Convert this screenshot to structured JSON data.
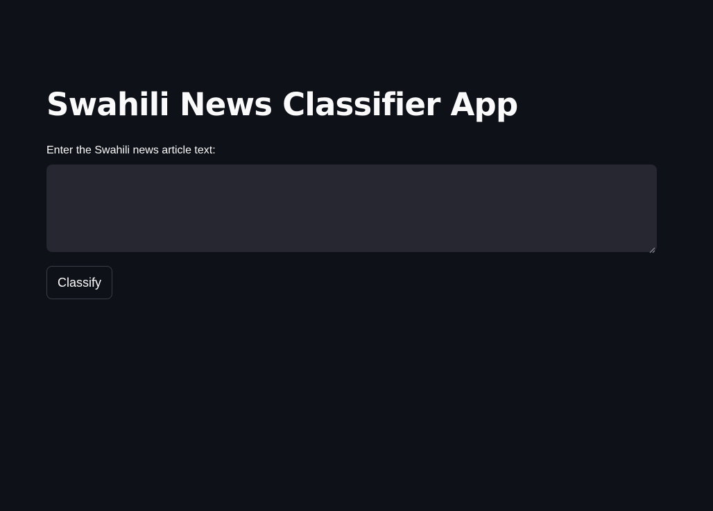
{
  "page": {
    "title": "Swahili News Classifier App"
  },
  "form": {
    "input_label": "Enter the Swahili news article text:",
    "input_value": "",
    "input_placeholder": "",
    "classify_label": "Classify"
  },
  "colors": {
    "background": "#0e1117",
    "text": "#fafafa",
    "input_background": "#262730",
    "button_border": "#3b3e47"
  },
  "icons": {
    "resize": "resize-handle-icon"
  }
}
